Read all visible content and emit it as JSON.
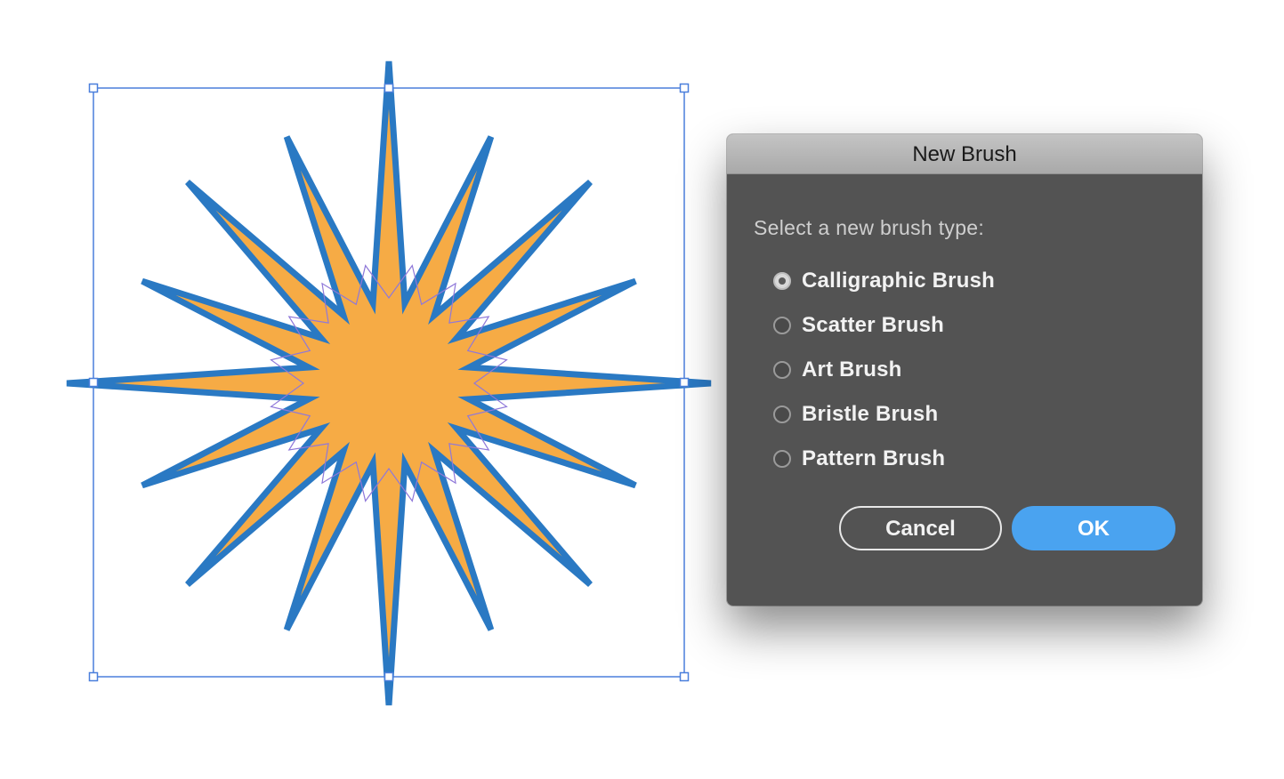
{
  "canvas": {
    "artwork": {
      "shape": "star-icon",
      "fill_color": "#f6ab45",
      "stroke_color": "#2a79c3",
      "inner_path_color": "#8f78d9",
      "selection_color": "#4a7fdc",
      "points": 16
    }
  },
  "dialog": {
    "title": "New Brush",
    "prompt": "Select a new brush type:",
    "options": [
      {
        "label": "Calligraphic Brush",
        "selected": true
      },
      {
        "label": "Scatter Brush",
        "selected": false
      },
      {
        "label": "Art Brush",
        "selected": false
      },
      {
        "label": "Bristle Brush",
        "selected": false
      },
      {
        "label": "Pattern Brush",
        "selected": false
      }
    ],
    "cancel_label": "Cancel",
    "ok_label": "OK",
    "accent_color": "#4aa3f0"
  }
}
